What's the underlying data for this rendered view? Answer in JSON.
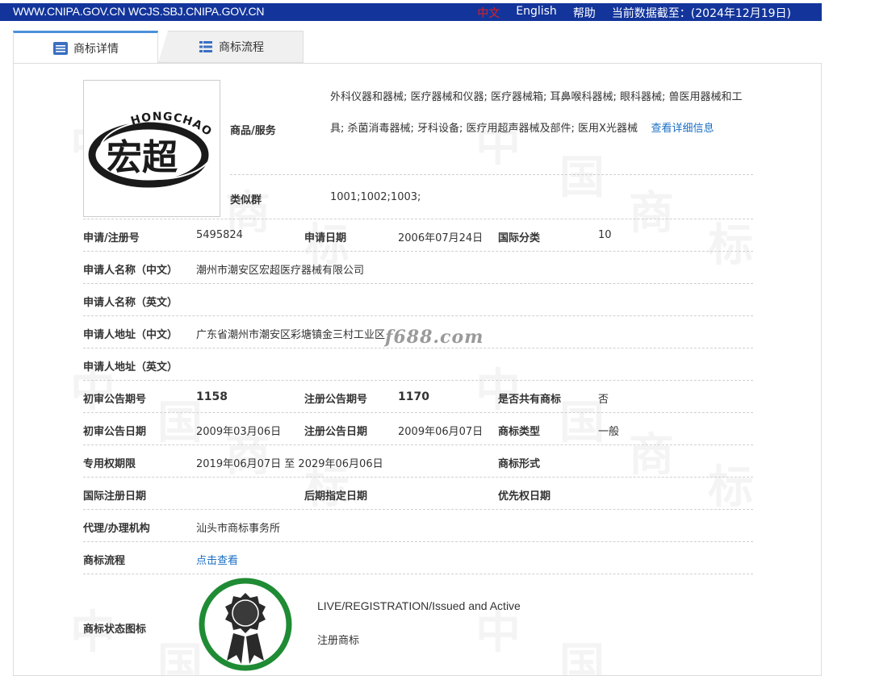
{
  "topbar": {
    "domains": "WWW.CNIPA.GOV.CN WCJS.SBJ.CNIPA.GOV.CN",
    "lang_cn": "中文",
    "lang_en": "English",
    "help": "帮助",
    "data_as_of": "当前数据截至：(2024年12月19日)"
  },
  "tabs": {
    "detail": "商标详情",
    "flow": "商标流程"
  },
  "logo": {
    "cn_text": "宏超",
    "en_text": "HONGCHAO"
  },
  "goods": {
    "label": "商品/服务",
    "text": "外科仪器和器械; 医疗器械和仪器; 医疗器械箱; 耳鼻喉科器械; 眼科器械; 兽医用器械和工具; 杀菌消毒器械; 牙科设备; 医疗用超声器械及部件; 医用X光器械",
    "more_link": "查看详细信息"
  },
  "similar": {
    "label": "类似群",
    "value": "1001;1002;1003;"
  },
  "fields": {
    "reg_no_label": "申请/注册号",
    "reg_no": "5495824",
    "app_date_label": "申请日期",
    "app_date": "2006年07月24日",
    "intl_class_label": "国际分类",
    "intl_class": "10",
    "applicant_cn_label": "申请人名称（中文）",
    "applicant_cn": "潮州市潮安区宏超医疗器械有限公司",
    "applicant_en_label": "申请人名称（英文）",
    "applicant_en": "",
    "address_cn_label": "申请人地址（中文）",
    "address_cn": "广东省潮州市潮安区彩塘镇金三村工业区",
    "address_en_label": "申请人地址（英文）",
    "address_en": "",
    "prelim_no_label": "初审公告期号",
    "prelim_no": "1158",
    "reg_pub_no_label": "注册公告期号",
    "reg_pub_no": "1170",
    "shared_label": "是否共有商标",
    "shared": "否",
    "prelim_date_label": "初审公告日期",
    "prelim_date": "2009年03月06日",
    "reg_pub_date_label": "注册公告日期",
    "reg_pub_date": "2009年06月07日",
    "mark_type_label": "商标类型",
    "mark_type": "一般",
    "term_label": "专用权期限",
    "term": "2019年06月07日 至 2029年06月06日",
    "mark_form_label": "商标形式",
    "mark_form": "",
    "intl_reg_date_label": "国际注册日期",
    "intl_reg_date": "",
    "later_date_label": "后期指定日期",
    "later_date": "",
    "priority_date_label": "优先权日期",
    "priority_date": "",
    "agent_label": "代理/办理机构",
    "agent": "汕头市商标事务所",
    "flow_label": "商标流程",
    "flow_link": "点击查看"
  },
  "watermark_site": "f688.com",
  "watermark_chars": [
    "中",
    "国",
    "商",
    "标"
  ],
  "status": {
    "label": "商标状态图标",
    "en": "LIVE/REGISTRATION/Issued and Active",
    "cn": "注册商标",
    "ring_color": "#1f8b34"
  }
}
